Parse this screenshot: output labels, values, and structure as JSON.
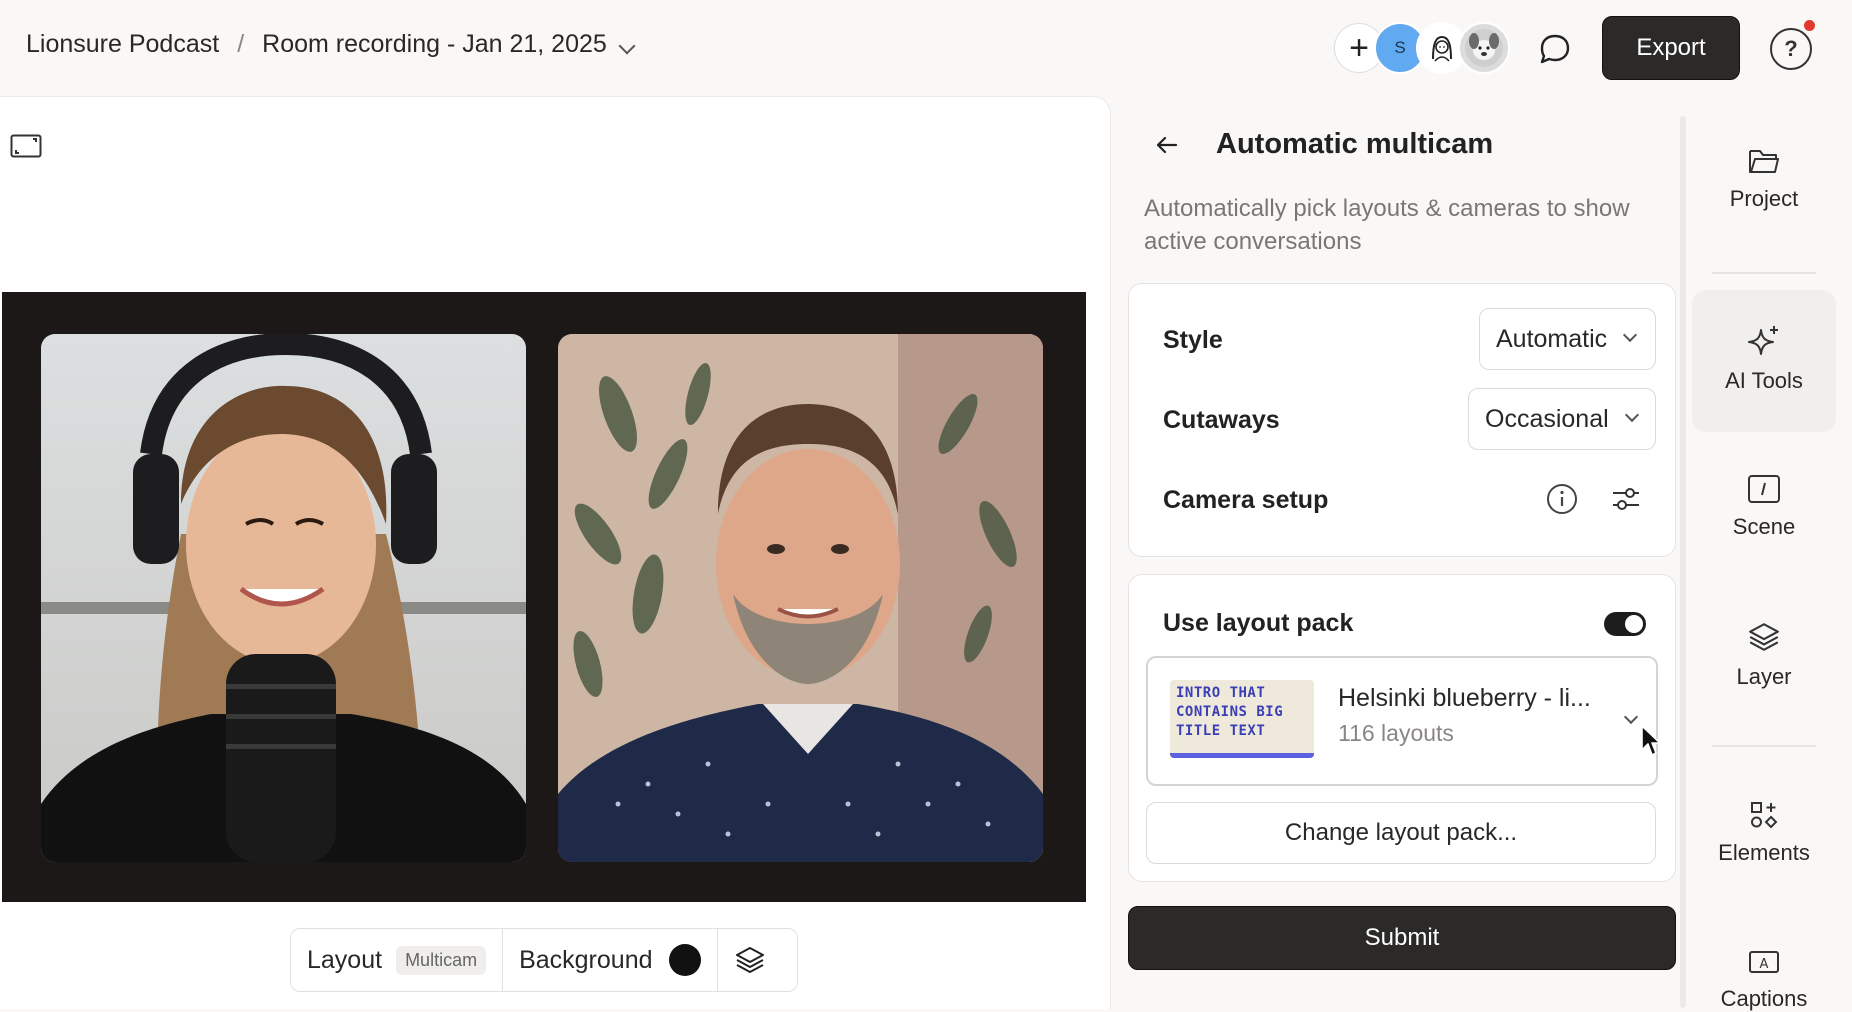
{
  "header": {
    "project": "Lionsure Podcast",
    "separator": "/",
    "recording": "Room recording - Jan 21, 2025",
    "avatar_initial": "S",
    "export_label": "Export",
    "help_label": "?"
  },
  "canvas": {
    "toolbar": {
      "layout_label": "Layout",
      "layout_badge": "Multicam",
      "background_label": "Background",
      "background_color": "#111111"
    }
  },
  "panel": {
    "title": "Automatic multicam",
    "description": "Automatically pick layouts & cameras to show active conversations",
    "style_label": "Style",
    "style_value": "Automatic",
    "cutaways_label": "Cutaways",
    "cutaways_value": "Occasional",
    "camera_setup_label": "Camera setup",
    "layout_pack_label": "Use layout pack",
    "layout_pack_enabled": true,
    "pack_thumb_text": "INTRO THAT CONTAINS BIG TITLE TEXT",
    "pack_name": "Helsinki blueberry - li...",
    "pack_count": "116 layouts",
    "change_pack_label": "Change layout pack...",
    "submit_label": "Submit"
  },
  "rail": {
    "items": [
      {
        "label": "Project",
        "icon": "folder-icon"
      },
      {
        "label": "AI Tools",
        "icon": "sparkle-icon",
        "active": true
      },
      {
        "label": "Scene",
        "icon": "scene-icon"
      },
      {
        "label": "Layer",
        "icon": "layers-icon"
      },
      {
        "label": "Elements",
        "icon": "elements-icon"
      },
      {
        "label": "Captions",
        "icon": "captions-icon"
      }
    ]
  },
  "colors": {
    "accent_dark": "#2b2a29",
    "notification": "#e0392e",
    "avatar_blue": "#61a9f0"
  }
}
